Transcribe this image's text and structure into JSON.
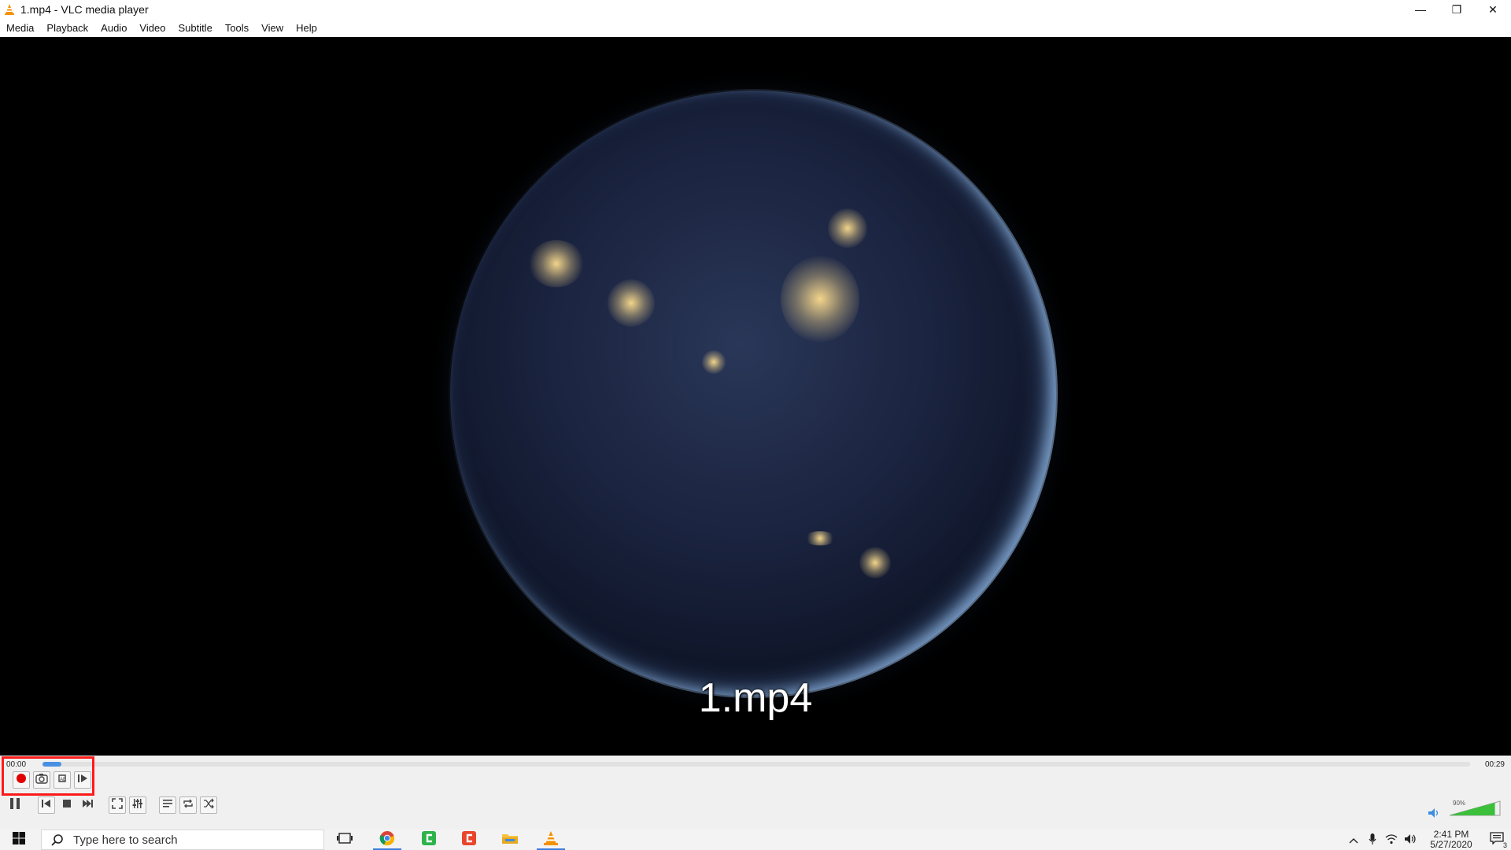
{
  "window": {
    "title": "1.mp4 - VLC media player",
    "controls": {
      "minimize": "—",
      "restore": "❐",
      "close": "✕"
    }
  },
  "menu": {
    "items": [
      "Media",
      "Playback",
      "Audio",
      "Video",
      "Subtitle",
      "Tools",
      "View",
      "Help"
    ]
  },
  "video": {
    "overlay_title": "1.mp4"
  },
  "player": {
    "time_elapsed": "00:00",
    "time_total": "00:29",
    "progress_fraction": 0.012,
    "volume_label": "90%",
    "volume_fraction": 0.9,
    "accent_color": "#ff1a1a",
    "advanced_controls": [
      "record-button",
      "snapshot-button",
      "loop-a-b-button",
      "frame-by-frame-button"
    ],
    "main_controls": [
      "pause-button",
      "previous-button",
      "stop-button",
      "next-button",
      "fullscreen-button",
      "extended-settings-button",
      "playlist-button",
      "loop-button",
      "shuffle-button"
    ]
  },
  "taskbar": {
    "search_placeholder": "Type here to search",
    "apps": [
      "task-view",
      "chrome",
      "camtasia-green",
      "camtasia-red",
      "file-explorer",
      "vlc"
    ],
    "clock_time": "2:41 PM",
    "clock_date": "5/27/2020",
    "notifications_count": "3"
  }
}
